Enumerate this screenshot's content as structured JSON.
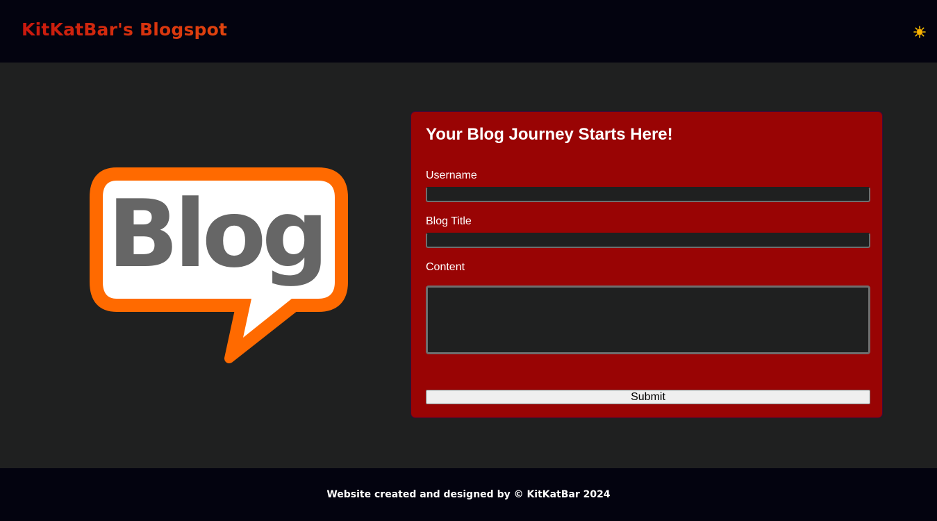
{
  "header": {
    "site_title": "KitKatBar's Blogspot",
    "theme_toggle_icon": "sun-icon"
  },
  "hero": {
    "logo_icon": "blog-speech-bubble-logo",
    "logo_text": "Blog"
  },
  "form": {
    "heading": "Your Blog Journey Starts Here!",
    "username_label": "Username",
    "username_value": "",
    "title_label": "Blog Title",
    "title_value": "",
    "content_label": "Content",
    "content_value": "",
    "submit_label": "Submit"
  },
  "footer": {
    "credit": "Website created and designed by © KitKatBar 2024"
  },
  "colors": {
    "header_bg": "#03030f",
    "page_bg": "#1f2020",
    "card_bg": "#990404",
    "title_red": "#c8180e",
    "logo_orange": "#ff6a00",
    "logo_text_gray": "#666666"
  }
}
